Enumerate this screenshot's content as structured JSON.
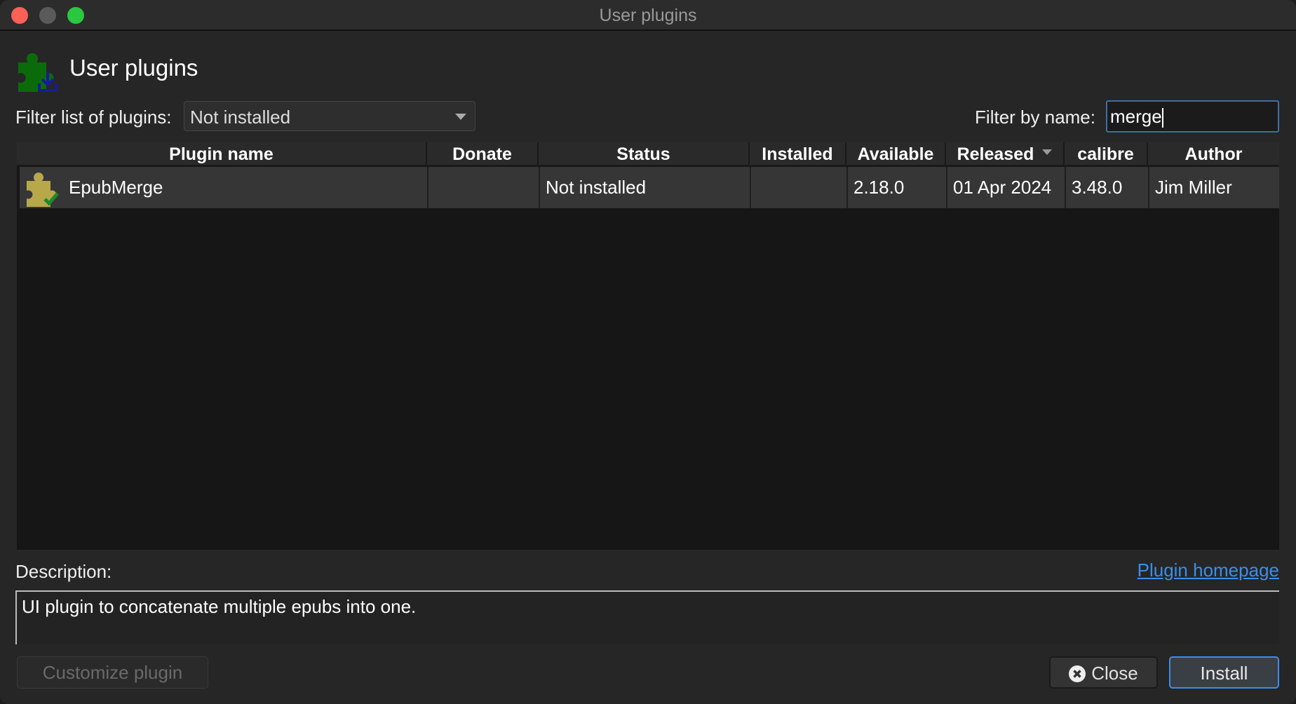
{
  "window": {
    "title": "User plugins"
  },
  "header": {
    "title": "User plugins",
    "icon": "puzzle-download-icon"
  },
  "filter": {
    "label": "Filter list of plugins:",
    "selected": "Not installed",
    "name_label": "Filter by name:",
    "name_value": "merge"
  },
  "table": {
    "columns": [
      "Plugin name",
      "Donate",
      "Status",
      "Installed",
      "Available",
      "Released",
      "calibre",
      "Author"
    ],
    "sorted_column": "Released",
    "rows": [
      {
        "name": "EpubMerge",
        "donate": "",
        "status": "Not installed",
        "installed": "",
        "available": "2.18.0",
        "released": "01 Apr 2024",
        "calibre": "3.48.0",
        "author": "Jim Miller"
      }
    ]
  },
  "description": {
    "label": "Description:",
    "link": "Plugin homepage",
    "text": "UI plugin to concatenate multiple epubs into one."
  },
  "buttons": {
    "customize": "Customize plugin",
    "close": "Close",
    "install": "Install"
  },
  "colors": {
    "accent": "#3b8eea",
    "link": "#3b8eea"
  }
}
